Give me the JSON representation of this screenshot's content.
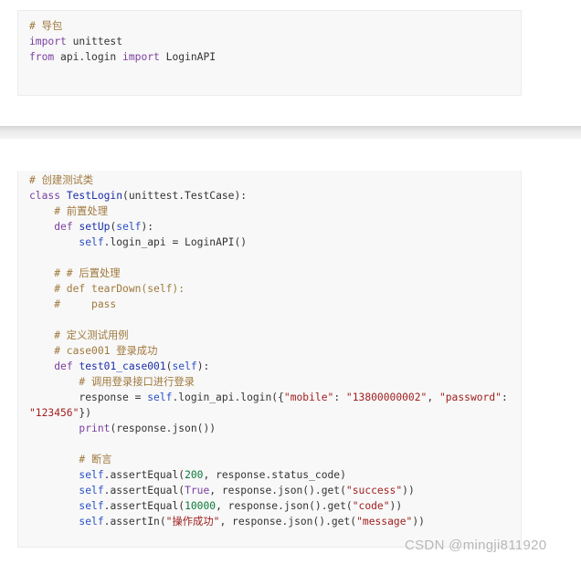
{
  "block1": {
    "lines": [
      [
        {
          "t": "# 导包",
          "c": "c-com"
        }
      ],
      [
        {
          "t": "import",
          "c": "c-kw"
        },
        {
          "t": " unittest",
          "c": "c-plain"
        }
      ],
      [
        {
          "t": "from",
          "c": "c-kw"
        },
        {
          "t": " api.login ",
          "c": "c-plain"
        },
        {
          "t": "import",
          "c": "c-kw"
        },
        {
          "t": " LoginAPI",
          "c": "c-plain"
        }
      ]
    ]
  },
  "block2": {
    "lines": [
      [
        {
          "t": "# 创建测试类",
          "c": "c-com"
        }
      ],
      [
        {
          "t": "class",
          "c": "c-kw"
        },
        {
          "t": " ",
          "c": "c-plain"
        },
        {
          "t": "TestLogin",
          "c": "c-def"
        },
        {
          "t": "(unittest.TestCase):",
          "c": "c-plain"
        }
      ],
      [
        {
          "t": "    # 前置处理",
          "c": "c-com"
        }
      ],
      [
        {
          "t": "    ",
          "c": "c-plain"
        },
        {
          "t": "def",
          "c": "c-kw"
        },
        {
          "t": " ",
          "c": "c-plain"
        },
        {
          "t": "setUp",
          "c": "c-def"
        },
        {
          "t": "(",
          "c": "c-plain"
        },
        {
          "t": "self",
          "c": "c-self"
        },
        {
          "t": "):",
          "c": "c-plain"
        }
      ],
      [
        {
          "t": "        ",
          "c": "c-plain"
        },
        {
          "t": "self",
          "c": "c-self"
        },
        {
          "t": ".login_api = LoginAPI()",
          "c": "c-plain"
        }
      ],
      [
        {
          "t": "",
          "c": "c-plain"
        }
      ],
      [
        {
          "t": "    # # 后置处理",
          "c": "c-com"
        }
      ],
      [
        {
          "t": "    # def tearDown(self):",
          "c": "c-com"
        }
      ],
      [
        {
          "t": "    #     pass",
          "c": "c-com"
        }
      ],
      [
        {
          "t": "",
          "c": "c-plain"
        }
      ],
      [
        {
          "t": "    # 定义测试用例",
          "c": "c-com"
        }
      ],
      [
        {
          "t": "    # case001 登录成功",
          "c": "c-com"
        }
      ],
      [
        {
          "t": "    ",
          "c": "c-plain"
        },
        {
          "t": "def",
          "c": "c-kw"
        },
        {
          "t": " ",
          "c": "c-plain"
        },
        {
          "t": "test01_case001",
          "c": "c-def"
        },
        {
          "t": "(",
          "c": "c-plain"
        },
        {
          "t": "self",
          "c": "c-self"
        },
        {
          "t": "):",
          "c": "c-plain"
        }
      ],
      [
        {
          "t": "        # 调用登录接口进行登录",
          "c": "c-com"
        }
      ],
      [
        {
          "t": "        response = ",
          "c": "c-plain"
        },
        {
          "t": "self",
          "c": "c-self"
        },
        {
          "t": ".login_api.login({",
          "c": "c-plain"
        },
        {
          "t": "\"mobile\"",
          "c": "c-str"
        },
        {
          "t": ": ",
          "c": "c-plain"
        },
        {
          "t": "\"13800000002\"",
          "c": "c-str"
        },
        {
          "t": ", ",
          "c": "c-plain"
        },
        {
          "t": "\"password\"",
          "c": "c-str"
        },
        {
          "t": ":",
          "c": "c-plain"
        }
      ],
      [
        {
          "t": "\"123456\"",
          "c": "c-str"
        },
        {
          "t": "})",
          "c": "c-plain"
        }
      ],
      [
        {
          "t": "        ",
          "c": "c-plain"
        },
        {
          "t": "print",
          "c": "c-kw"
        },
        {
          "t": "(response.json())",
          "c": "c-plain"
        }
      ],
      [
        {
          "t": "",
          "c": "c-plain"
        }
      ],
      [
        {
          "t": "        # 断言",
          "c": "c-com"
        }
      ],
      [
        {
          "t": "        ",
          "c": "c-plain"
        },
        {
          "t": "self",
          "c": "c-self"
        },
        {
          "t": ".assertEqual(",
          "c": "c-plain"
        },
        {
          "t": "200",
          "c": "c-num"
        },
        {
          "t": ", response.status_code)",
          "c": "c-plain"
        }
      ],
      [
        {
          "t": "        ",
          "c": "c-plain"
        },
        {
          "t": "self",
          "c": "c-self"
        },
        {
          "t": ".assertEqual(",
          "c": "c-plain"
        },
        {
          "t": "True",
          "c": "c-kw"
        },
        {
          "t": ", response.json().get(",
          "c": "c-plain"
        },
        {
          "t": "\"success\"",
          "c": "c-str"
        },
        {
          "t": "))",
          "c": "c-plain"
        }
      ],
      [
        {
          "t": "        ",
          "c": "c-plain"
        },
        {
          "t": "self",
          "c": "c-self"
        },
        {
          "t": ".assertEqual(",
          "c": "c-plain"
        },
        {
          "t": "10000",
          "c": "c-num"
        },
        {
          "t": ", response.json().get(",
          "c": "c-plain"
        },
        {
          "t": "\"code\"",
          "c": "c-str"
        },
        {
          "t": "))",
          "c": "c-plain"
        }
      ],
      [
        {
          "t": "        ",
          "c": "c-plain"
        },
        {
          "t": "self",
          "c": "c-self"
        },
        {
          "t": ".assertIn(",
          "c": "c-plain"
        },
        {
          "t": "\"操作成功\"",
          "c": "c-str"
        },
        {
          "t": ", response.json().get(",
          "c": "c-plain"
        },
        {
          "t": "\"message\"",
          "c": "c-str"
        },
        {
          "t": "))",
          "c": "c-plain"
        }
      ]
    ]
  },
  "watermark": "CSDN @mingji811920"
}
